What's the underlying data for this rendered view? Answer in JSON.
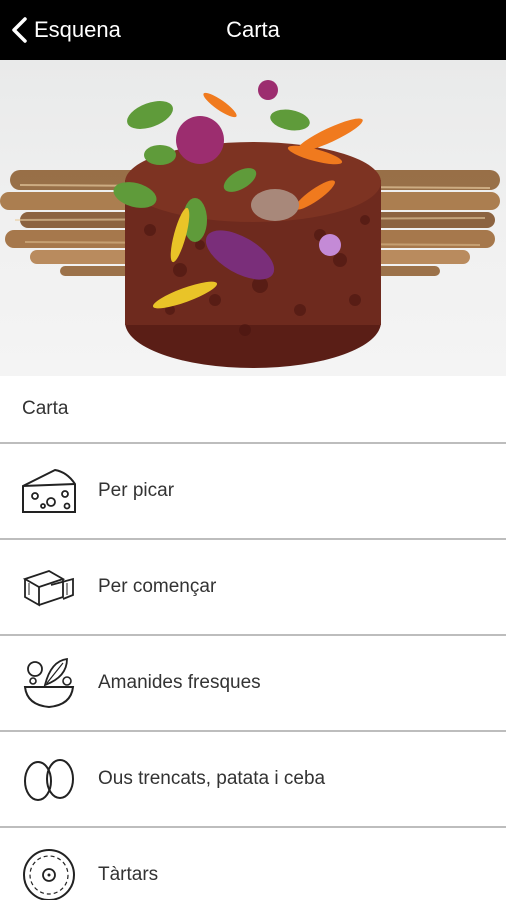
{
  "header": {
    "back_label": "Esquena",
    "title": "Carta"
  },
  "section": {
    "title": "Carta"
  },
  "menu": {
    "items": [
      {
        "label": "Per picar",
        "icon": "cheese-icon"
      },
      {
        "label": "Per començar",
        "icon": "ravioli-icon"
      },
      {
        "label": "Amanides fresques",
        "icon": "salad-bowl-icon"
      },
      {
        "label": "Ous trencats, patata i ceba",
        "icon": "eggs-icon"
      },
      {
        "label": "Tàrtars",
        "icon": "tartar-plate-icon"
      }
    ]
  },
  "colors": {
    "topbar": "#000000",
    "divider": "#bdbdbd",
    "text": "#333333"
  }
}
